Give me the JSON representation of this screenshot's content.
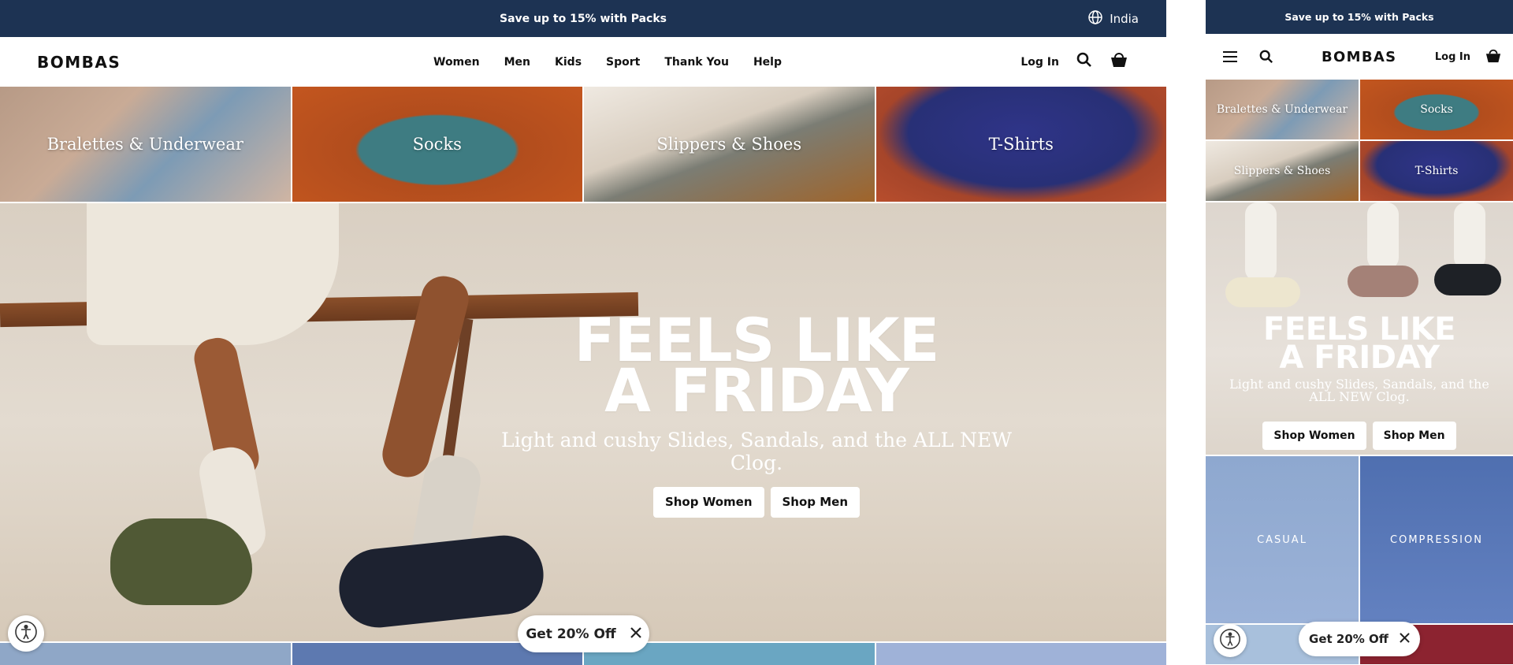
{
  "desktop": {
    "announcement": "Save up to 15% with Packs",
    "locale": "India",
    "logo": "BOMBAS",
    "nav": [
      "Women",
      "Men",
      "Kids",
      "Sport",
      "Thank You",
      "Help"
    ],
    "login": "Log In",
    "categories": [
      "Bralettes & Underwear",
      "Socks",
      "Slippers & Shoes",
      "T-Shirts"
    ],
    "hero": {
      "title_line1": "FEELS LIKE",
      "title_line2": "A FRIDAY",
      "subtitle": "Light and cushy Slides, Sandals, and the ALL NEW Clog.",
      "shop_women": "Shop Women",
      "shop_men": "Shop Men"
    },
    "promo": "Get 20% Off"
  },
  "mobile": {
    "announcement": "Save up to 15% with Packs",
    "logo": "BOMBAS",
    "login": "Log In",
    "categories": [
      "Bralettes & Underwear",
      "Socks",
      "Slippers & Shoes",
      "T-Shirts"
    ],
    "hero": {
      "title_line1": "FEELS LIKE",
      "title_line2": "A FRIDAY",
      "subtitle": "Light and cushy Slides, Sandals, and the ALL NEW Clog.",
      "shop_women": "Shop Women",
      "shop_men": "Shop Men"
    },
    "tiles": [
      "CASUAL",
      "COMPRESSION"
    ],
    "promo": "Get 20% Off"
  },
  "colors": {
    "announcement_bg": "#1d3353",
    "text_dark": "#111111",
    "white": "#ffffff"
  },
  "icons": [
    "globe-icon",
    "search-icon",
    "cart-icon",
    "menu-icon",
    "close-icon",
    "accessibility-icon"
  ]
}
